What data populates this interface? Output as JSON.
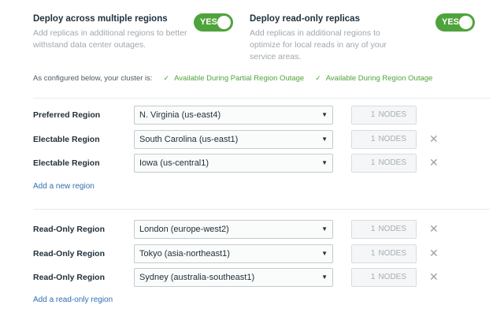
{
  "options": {
    "multi_region": {
      "title": "Deploy across multiple regions",
      "description": "Add replicas in additional regions to better withstand data center outages.",
      "toggle": "YES"
    },
    "read_only": {
      "title": "Deploy read-only replicas",
      "description": "Add replicas in additional regions to optimize for local reads in any of your service areas.",
      "toggle": "YES"
    }
  },
  "status": {
    "intro": "As configured below, your cluster is:",
    "items": [
      "Available During Partial Region Outage",
      "Available During Region Outage"
    ]
  },
  "electable": {
    "rows": [
      {
        "label": "Preferred Region",
        "region": "N. Virginia (us-east4)",
        "nodes": "1",
        "unit": "NODES",
        "removable": false
      },
      {
        "label": "Electable Region",
        "region": "South Carolina (us-east1)",
        "nodes": "1",
        "unit": "NODES",
        "removable": true
      },
      {
        "label": "Electable Region",
        "region": "Iowa (us-central1)",
        "nodes": "1",
        "unit": "NODES",
        "removable": true
      }
    ],
    "add_link": "Add a new region"
  },
  "readonly": {
    "rows": [
      {
        "label": "Read-Only Region",
        "region": "London (europe-west2)",
        "nodes": "1",
        "unit": "NODES",
        "removable": true
      },
      {
        "label": "Read-Only Region",
        "region": "Tokyo (asia-northeast1)",
        "nodes": "1",
        "unit": "NODES",
        "removable": true
      },
      {
        "label": "Read-Only Region",
        "region": "Sydney (australia-southeast1)",
        "nodes": "1",
        "unit": "NODES",
        "removable": true
      }
    ],
    "add_link": "Add a read-only region"
  },
  "icons": {
    "check": "check-icon",
    "remove": "close-icon",
    "dropdown": "dropdown-arrow-icon"
  },
  "colors": {
    "accent_green": "#4fa33c",
    "link_blue": "#2f6fb3"
  }
}
